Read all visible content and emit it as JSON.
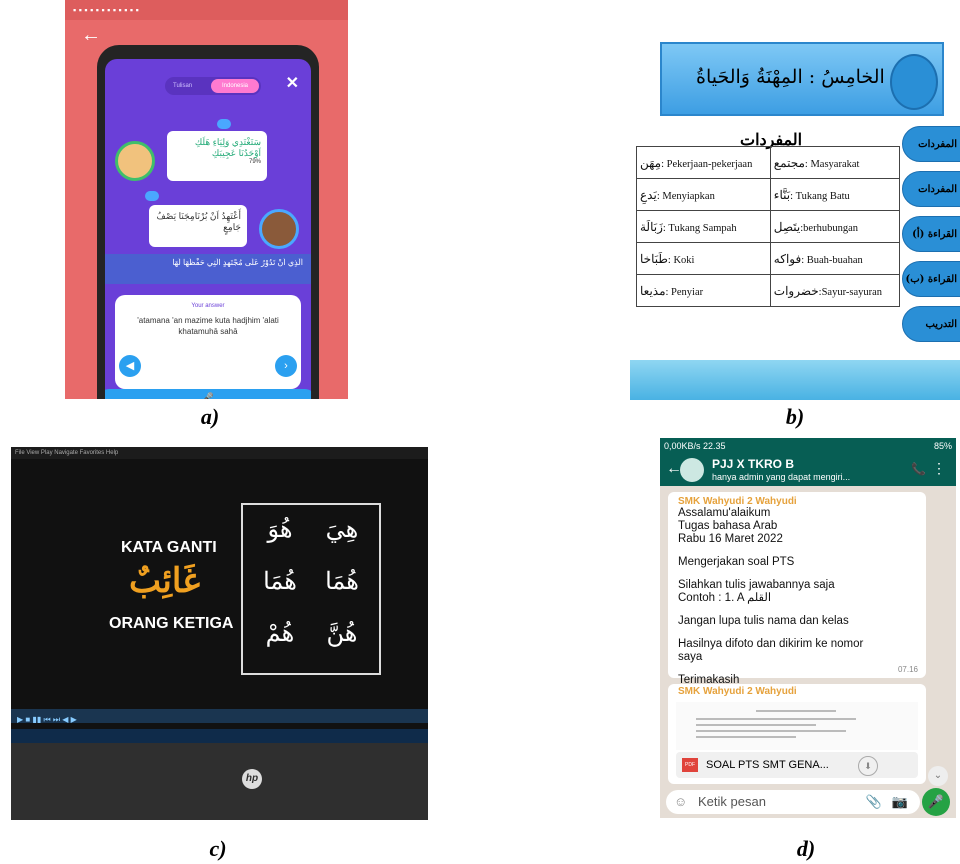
{
  "captions": {
    "a": "a)",
    "b": "b)",
    "c": "c)",
    "d": "d)"
  },
  "panel_a": {
    "toggle_left": "Tulisan",
    "toggle_right": "Indonesia",
    "bubble1": "سَتَغْتَدِي وَلِيَاءِ هَلَكِ اَوْحَدُنَا عَجِيبَكِ",
    "bubble1_small": "79%",
    "bubble2": "أَعْتَهِدُ اَنْ بُرْنَامِجَنَا يَصْفُ جَامِعٍ",
    "strip_arabic": "اَلَّذِي اَنْ تَدُوْرُ عَلَى مُجْتَهِدٍ الَّتِي حَفْظَهَا لَهَا",
    "answer_header": "Your answer",
    "answer_text": "'atamana 'an mazime kuta hadjhim 'alati khatamuhā sahā",
    "mic_icon": "mic-icon"
  },
  "panel_b": {
    "title": "البابُ الخامِسُ : المِهْنَةُ وَالحَياةُ",
    "subtitle": "المفردات",
    "rows": [
      {
        "left_ar": "مِهَن",
        "left_id": ": Pekerjaan-pekerjaan",
        "right_ar": "مجتمع",
        "right_id": ": Masyarakat"
      },
      {
        "left_ar": "يَدعِ",
        "left_id": ": Menyiapkan",
        "right_ar": "بَنَّاء",
        "right_id": ": Tukang Batu"
      },
      {
        "left_ar": "زَبَالَة",
        "left_id": ": Tukang Sampah",
        "right_ar": "يتَصِل",
        "right_id": ":berhubungan"
      },
      {
        "left_ar": "طَبَاخا",
        "left_id": ": Koki",
        "right_ar": "فواكه",
        "right_id": ": Buah-buahan"
      },
      {
        "left_ar": "مذيعا",
        "left_id": ": Penyiar",
        "right_ar": "خضروات",
        "right_id": ":Sayur-sayuran"
      }
    ],
    "nav": [
      "المفردات (أ)",
      "المفردات (ب)",
      "القراءة (أ)",
      "القراءة (ب)",
      "التدريب"
    ]
  },
  "panel_c": {
    "menu": "File  View  Play  Navigate  Favorites  Help",
    "kata_ganti": "KATA GANTI",
    "ghaib": "غَائِبٌ",
    "orang_ketiga": "ORANG KETIGA",
    "pronouns": [
      "هِيَ",
      "هُوَ",
      "هُمَا",
      "هُمَا",
      "هُنَّ",
      "هُمْ"
    ],
    "logo": "hp"
  },
  "panel_d": {
    "status_left": "0,00KB/s  22.35",
    "status_right": "85%",
    "group_name": "PJJ X TKRO B",
    "group_sub": "hanya admin yang dapat mengiri...",
    "sender": "SMK Wahyudi 2 Wahyudi",
    "lines": [
      "Assalamu'alaikum",
      "Tugas  bahasa Arab",
      "Rabu 16 Maret 2022",
      "",
      "Mengerjakan soal PTS",
      "",
      "Silahkan tulis jawabannya saja",
      "Contoh : 1. A القلم",
      "",
      "Jangan lupa tulis nama dan kelas",
      "",
      "Hasilnya difoto dan dikirim ke nomor",
      "saya",
      "",
      "Terimakasih"
    ],
    "time": "07.16",
    "sender2": "SMK Wahyudi 2 Wahyudi",
    "file_label": "PDF",
    "file_name": "SOAL PTS SMT GENA...",
    "input_placeholder": "Ketik pesan"
  }
}
